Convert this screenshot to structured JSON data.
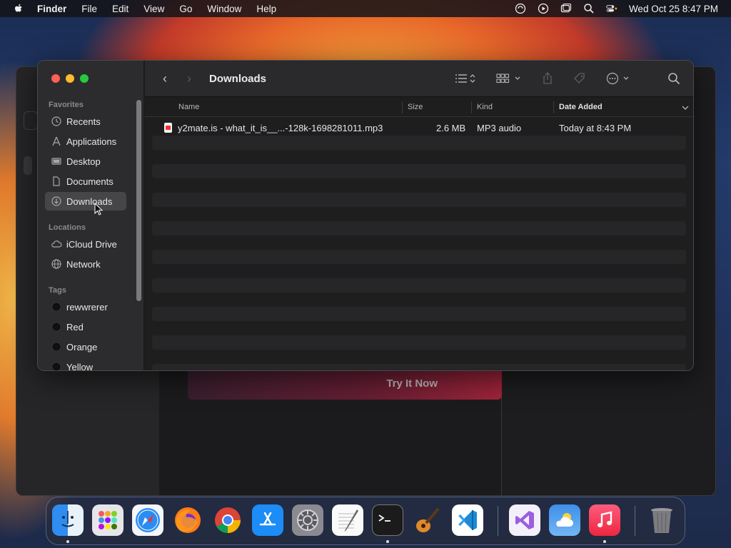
{
  "menubar": {
    "app": "Finder",
    "items": [
      "File",
      "Edit",
      "View",
      "Go",
      "Window",
      "Help"
    ],
    "clock": "Wed Oct 25  8:47 PM"
  },
  "background_window": {
    "button_label": "Try It Now"
  },
  "finder": {
    "title": "Downloads",
    "sidebar": {
      "favorites_label": "Favorites",
      "favorites": [
        {
          "label": "Recents",
          "icon": "clock-icon"
        },
        {
          "label": "Applications",
          "icon": "applications-icon"
        },
        {
          "label": "Desktop",
          "icon": "desktop-icon"
        },
        {
          "label": "Documents",
          "icon": "document-icon"
        },
        {
          "label": "Downloads",
          "icon": "download-icon",
          "selected": true
        }
      ],
      "locations_label": "Locations",
      "locations": [
        {
          "label": "iCloud Drive",
          "icon": "cloud-icon"
        },
        {
          "label": "Network",
          "icon": "globe-icon"
        }
      ],
      "tags_label": "Tags",
      "tags": [
        {
          "label": "rewwrerer",
          "color": "#111111"
        },
        {
          "label": "Red",
          "color": "#111111"
        },
        {
          "label": "Orange",
          "color": "#111111"
        },
        {
          "label": "Yellow",
          "color": "#111111"
        }
      ]
    },
    "columns": {
      "name": "Name",
      "size": "Size",
      "kind": "Kind",
      "date": "Date Added"
    },
    "files": [
      {
        "name": "y2mate.is - what_it_is__...-128k-1698281011.mp3",
        "size": "2.6 MB",
        "kind": "MP3 audio",
        "date": "Today at 8:43 PM"
      }
    ]
  },
  "dock": {
    "apps": [
      "Finder",
      "Launchpad",
      "Safari",
      "Firefox",
      "Chrome",
      "App Store",
      "System Settings",
      "TextEdit",
      "Terminal",
      "GarageBand",
      "Visual Studio Code",
      "Visual Studio",
      "Weather",
      "Music",
      "Trash"
    ]
  },
  "colors": {
    "accent_red": "#fe5f57",
    "accent_yellow": "#febc2e",
    "accent_green": "#28c840"
  }
}
